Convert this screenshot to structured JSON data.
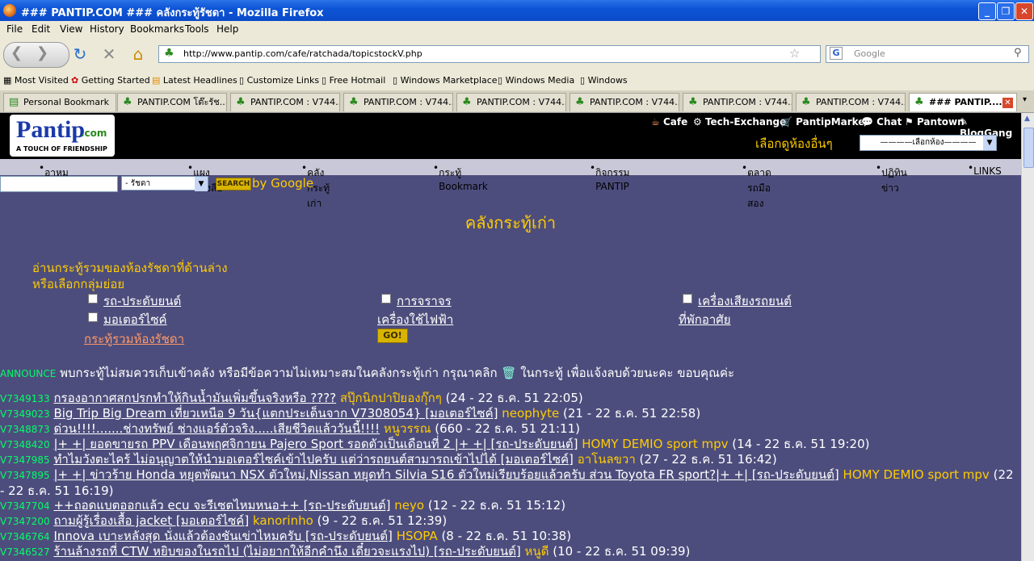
{
  "window": {
    "title": "### PANTIP.COM ### คลังกระทู้รัชดา - Mozilla Firefox"
  },
  "menu": [
    "File",
    "Edit",
    "View",
    "History",
    "Bookmarks",
    "Tools",
    "Help"
  ],
  "address": {
    "url": "http://www.pantip.com/cafe/ratchada/topicstockV.php"
  },
  "search": {
    "placeholder": "Google"
  },
  "bookmarks": [
    "Most Visited",
    "Getting Started",
    "Latest Headlines",
    "Customize Links",
    "Free Hotmail",
    "Windows Marketplace",
    "Windows Media",
    "Windows"
  ],
  "tabs": [
    "Personal Bookmark",
    "PANTIP.COM โต๊ะรัช...",
    "PANTIP.COM : V744...",
    "PANTIP.COM : V744...",
    "PANTIP.COM : V744...",
    "PANTIP.COM : V744...",
    "PANTIP.COM : V744...",
    "PANTIP.COM : V744...",
    "### PANTIP...."
  ],
  "site": {
    "logo_text": "Pantip",
    "logo_domain": ".com",
    "logo_slogan": "A TOUCH OF FRIENDSHIP",
    "topnav": [
      "Cafe",
      "Tech-Exchange",
      "PantipMarket",
      "Chat",
      "Pantown",
      "BlogGang"
    ],
    "other_rooms_label": "เลือกดูห้องอื่นๆ",
    "room_select": "————เลือกห้อง————",
    "subnav": [
      "อาหมูออนดีมานด์",
      "แผงหนังสือ",
      "คลังกระทู้เก่า",
      "กระทู้ Bookmark",
      "กิจกรรม PANTIP",
      "ตลาดรถมือสอง",
      "ปฏิทินข่าว",
      "LINKS"
    ],
    "search_scope": "- รัชดา",
    "search_button": "SEARCH",
    "by_google": "by Google"
  },
  "page": {
    "title": "คลังกระทู้เก่า",
    "intro1": "อ่านกระทู้รวมของห้องรัชดาที่ด้านล่าง",
    "intro2": "หรือเลือกกลุ่มย่อย",
    "categories": [
      "รถ-ประดับยนต์",
      "การจราจร",
      "เครื่องเสียงรถยนต์",
      "มอเตอร์ไซค์",
      "เครื่องใช้ไฟฟ้า",
      "ที่พักอาศัย"
    ],
    "all_link": "กระทู้รวมห้องรัชดา",
    "go_button": "GO!",
    "announce_label": "ANNOUNCE",
    "announce_text1": "พบกระทู้ไม่สมควรเก็บเข้าคลัง หรือมีข้อความไม่เหมาะสมในคลังกระทู้เก่า กรุณาคลิก",
    "announce_text2": "ในกระทู้ เพื่อแจ้งลบด้วยนะคะ ขอบคุณค่ะ"
  },
  "topics": [
    {
      "id": "V7349133",
      "title": "กรองอากาศสกปรกทำให้กินน้ำมันเพิ่มขึ้นจริงหรือ ????",
      "author": "สปุ๊กนิกปาปิยองกุ๊กๆ",
      "meta": "(24 - 22 ธ.ค. 51 22:05)"
    },
    {
      "id": "V7349023",
      "title": "Big Trip Big Dream เที่ยวเหนือ 9 วัน{แตกประเด็นจาก V7308054} [มอเตอร์ไซค์]",
      "author": "neophyte",
      "meta": "(21 - 22 ธ.ค. 51 22:58)"
    },
    {
      "id": "V7348873",
      "title": "ด่วน!!!!.......ช่างทรัพย์ ช่างแอร์ตัวจริง.....เสียชีวิตแล้ววันนี้!!!!",
      "author": "หนูวรรณ",
      "meta": "(660 - 22 ธ.ค. 51 21:11)"
    },
    {
      "id": "V7348420",
      "title": "|+ +| ยอดขายรถ PPV เดือนพฤศจิกายน Pajero Sport รอดตัวเป็นเดือนที่ 2 |+ +| [รถ-ประดับยนต์]",
      "author": "HOMY DEMIO sport mpv",
      "meta": "(14 - 22 ธ.ค. 51 19:20)"
    },
    {
      "id": "V7347985",
      "title": "ทำไมวังตะไคร้ ไม่อนุญาตให้นำมอเตอร์ไซค์เข้าไปครับ แต่ว่ารถยนต์สามารถเข้าไปได้ [มอเตอร์ไซค์]",
      "author": "อาโนลขวา",
      "meta": "(27 - 22 ธ.ค. 51 16:42)"
    },
    {
      "id": "V7347895",
      "title": "|+ +| ข่าวร้าย Honda หยุดพัฒนา NSX ตัวใหม่,Nissan หยุดทำ Silvia S16 ตัวใหม่เรียบร้อยแล้วครับ ส่วน Toyota FR sport?|+ +| [รถ-ประดับยนต์]",
      "author": "HOMY DEMIO sport mpv",
      "meta": "(22 - 22 ธ.ค. 51 16:19)"
    },
    {
      "id": "V7347704",
      "title": "++ถอดแบตออกแล้ว ecu จะรีเซตไหมหนอ++ [รถ-ประดับยนต์]",
      "author": "neyo",
      "meta": "(12 - 22 ธ.ค. 51 15:12)"
    },
    {
      "id": "V7347200",
      "title": "ถามผู้รู้เรื่องเสื้อ jacket [มอเตอร์ไซค์]",
      "author": "kanorinho",
      "meta": "(9 - 22 ธ.ค. 51 12:39)"
    },
    {
      "id": "V7346764",
      "title": "Innova เบาะหลังสุด นั่งแล้วต้องชันเข่าไหมครับ [รถ-ประดับยนต์]",
      "author": "HSOPA",
      "meta": "(8 - 22 ธ.ค. 51 10:38)"
    },
    {
      "id": "V7346527",
      "title": "ร้านล้างรถที่ CTW หยิบของในรถไป (ไม่อยากให้อีกคำนึง เดี๋ยวจะแรงไป) [รถ-ประดับยนต์]",
      "author": "หนูดี",
      "meta": "(10 - 22 ธ.ค. 51 09:39)"
    }
  ]
}
